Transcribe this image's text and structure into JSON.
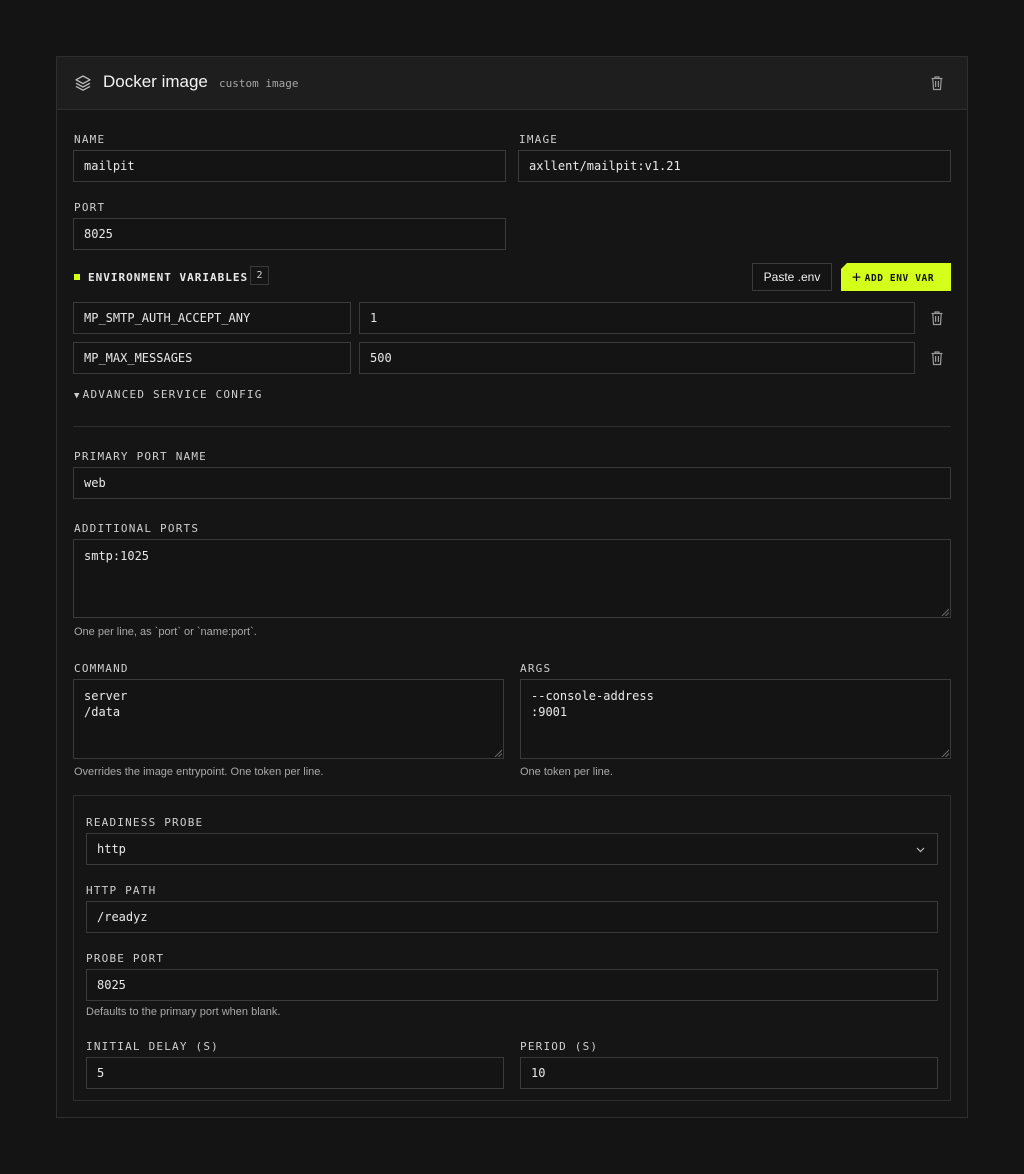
{
  "header": {
    "title": "Docker image",
    "badge": "custom image"
  },
  "fields": {
    "name": {
      "label": "NAME",
      "value": "mailpit"
    },
    "image": {
      "label": "IMAGE",
      "value": "axllent/mailpit:v1.21"
    },
    "port": {
      "label": "PORT",
      "value": "8025"
    }
  },
  "env": {
    "title": "ENVIRONMENT VARIABLES",
    "count": "2",
    "paste_label": "Paste .env",
    "add_label": "ADD ENV VAR",
    "vars": [
      {
        "key": "MP_SMTP_AUTH_ACCEPT_ANY",
        "value": "1"
      },
      {
        "key": "MP_MAX_MESSAGES",
        "value": "500"
      }
    ]
  },
  "advanced": {
    "toggle_label": "ADVANCED SERVICE CONFIG",
    "expanded": true,
    "primary_port_name": {
      "label": "PRIMARY PORT NAME",
      "value": "web"
    },
    "additional_ports": {
      "label": "ADDITIONAL PORTS",
      "value": "smtp:1025",
      "hint": "One per line, as `port` or `name:port`."
    },
    "command": {
      "label": "COMMAND",
      "value": "server\n/data",
      "hint": "Overrides the image entrypoint. One token per line."
    },
    "args": {
      "label": "ARGS",
      "value": "--console-address\n:9001",
      "hint": "One token per line."
    }
  },
  "probe": {
    "readiness": {
      "label": "READINESS PROBE",
      "value": "http"
    },
    "http_path": {
      "label": "HTTP PATH",
      "value": "/readyz"
    },
    "probe_port": {
      "label": "PROBE PORT",
      "value": "8025",
      "hint": "Defaults to the primary port when blank."
    },
    "initial_delay": {
      "label": "INITIAL DELAY (S)",
      "value": "5"
    },
    "period": {
      "label": "PERIOD (S)",
      "value": "10"
    }
  },
  "colors": {
    "accent": "#d4ff1a",
    "background": "#141414",
    "card_header": "#1e1e1e",
    "border": "#3a3a3a"
  },
  "icons": {
    "header": "layers-icon",
    "delete": "trash-icon",
    "select": "chevron-down-icon",
    "add": "plus-icon",
    "toggle": "caret-down-icon"
  }
}
